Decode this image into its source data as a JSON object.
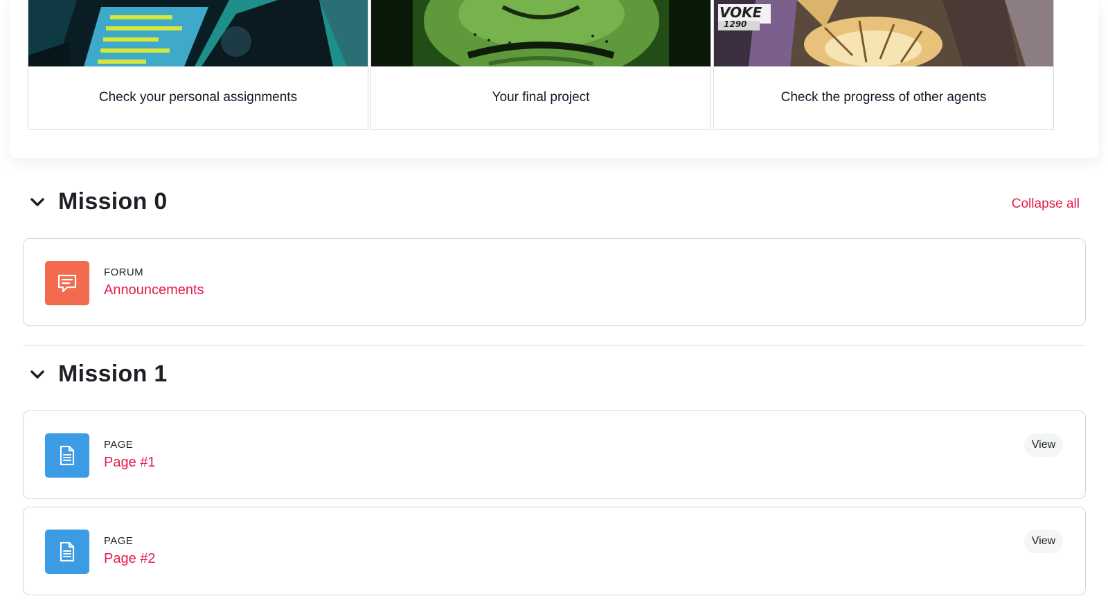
{
  "cards": [
    {
      "label": "Check your personal assignments",
      "image": "comic-laptop-illustration"
    },
    {
      "label": "Your final project",
      "image": "comic-green-face-illustration"
    },
    {
      "label": "Check the progress of other agents",
      "image": "comic-explosion-illustration",
      "art_text": "VOKE",
      "art_subtext": "1290"
    }
  ],
  "sections": [
    {
      "title": "Mission 0",
      "collapse_all": "Collapse all",
      "activities": [
        {
          "type": "FORUM",
          "name": "Announcements",
          "icon": "forum-icon",
          "color": "#f36b4e"
        }
      ]
    },
    {
      "title": "Mission 1",
      "activities": [
        {
          "type": "PAGE",
          "name": "Page #1",
          "icon": "page-icon",
          "color": "#3b9be3",
          "action": "View"
        },
        {
          "type": "PAGE",
          "name": "Page #2",
          "icon": "page-icon",
          "color": "#3b9be3",
          "action": "View"
        }
      ]
    }
  ],
  "colors": {
    "accent": "#e6194b",
    "forum": "#f36b4e",
    "page": "#3b9be3"
  }
}
